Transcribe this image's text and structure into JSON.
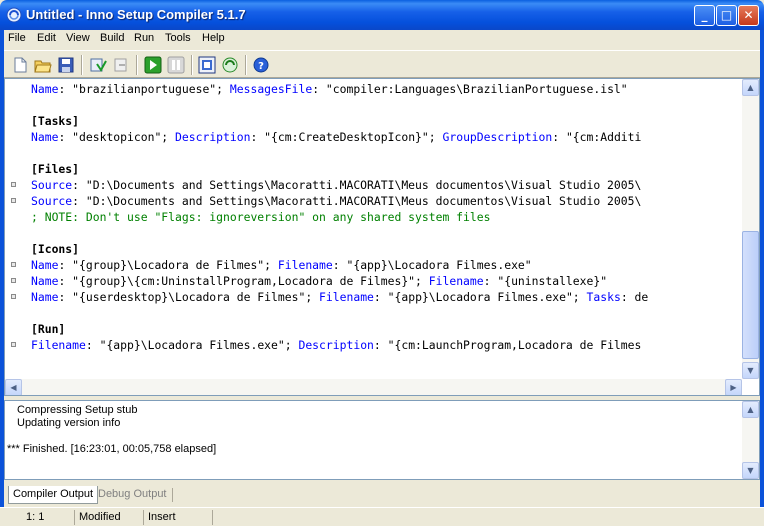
{
  "window": {
    "title": "Untitled - Inno Setup Compiler 5.1.7",
    "minimize": "_",
    "maximize": "□",
    "close": "✕"
  },
  "menu": [
    "File",
    "Edit",
    "View",
    "Build",
    "Run",
    "Tools",
    "Help"
  ],
  "toolbar": [
    "new-icon",
    "open-icon",
    "save-icon",
    "compile-icon",
    "stop-compile-icon",
    "run-icon",
    "pause-icon",
    "target-setup-icon",
    "uninstall-icon",
    "help-icon"
  ],
  "editor": {
    "lines": [
      {
        "parts": [
          [
            "kw",
            "Name"
          ],
          [
            "t",
            ": \"brazilianportuguese\"; "
          ],
          [
            "kw",
            "MessagesFile"
          ],
          [
            "t",
            ": \"compiler:Languages\\BrazilianPortuguese.isl\""
          ]
        ],
        "marker": false
      },
      {
        "parts": [],
        "marker": false
      },
      {
        "parts": [
          [
            "sec",
            "[Tasks]"
          ]
        ],
        "marker": false
      },
      {
        "parts": [
          [
            "kw",
            "Name"
          ],
          [
            "t",
            ": \"desktopicon\"; "
          ],
          [
            "kw",
            "Description"
          ],
          [
            "t",
            ": \"{cm:CreateDesktopIcon}\"; "
          ],
          [
            "kw",
            "GroupDescription"
          ],
          [
            "t",
            ": \"{cm:Additi"
          ]
        ],
        "marker": false
      },
      {
        "parts": [],
        "marker": false
      },
      {
        "parts": [
          [
            "sec",
            "[Files]"
          ]
        ],
        "marker": false
      },
      {
        "parts": [
          [
            "kw",
            "Source"
          ],
          [
            "t",
            ": \"D:\\Documents and Settings\\Macoratti.MACORATI\\Meus documentos\\Visual Studio 2005\\"
          ]
        ],
        "marker": true
      },
      {
        "parts": [
          [
            "kw",
            "Source"
          ],
          [
            "t",
            ": \"D:\\Documents and Settings\\Macoratti.MACORATI\\Meus documentos\\Visual Studio 2005\\"
          ]
        ],
        "marker": true
      },
      {
        "parts": [
          [
            "cmt",
            "; NOTE: Don't use \"Flags: ignoreversion\" on any shared system files"
          ]
        ],
        "marker": false
      },
      {
        "parts": [],
        "marker": false
      },
      {
        "parts": [
          [
            "sec",
            "[Icons]"
          ]
        ],
        "marker": false
      },
      {
        "parts": [
          [
            "kw",
            "Name"
          ],
          [
            "t",
            ": \"{group}\\Locadora de Filmes\"; "
          ],
          [
            "kw",
            "Filename"
          ],
          [
            "t",
            ": \"{app}\\Locadora Filmes.exe\""
          ]
        ],
        "marker": true
      },
      {
        "parts": [
          [
            "kw",
            "Name"
          ],
          [
            "t",
            ": \"{group}\\{cm:UninstallProgram,Locadora de Filmes}\"; "
          ],
          [
            "kw",
            "Filename"
          ],
          [
            "t",
            ": \"{uninstallexe}\""
          ]
        ],
        "marker": true
      },
      {
        "parts": [
          [
            "kw",
            "Name"
          ],
          [
            "t",
            ": \"{userdesktop}\\Locadora de Filmes\"; "
          ],
          [
            "kw",
            "Filename"
          ],
          [
            "t",
            ": \"{app}\\Locadora Filmes.exe\"; "
          ],
          [
            "kw",
            "Tasks"
          ],
          [
            "t",
            ": de"
          ]
        ],
        "marker": true
      },
      {
        "parts": [],
        "marker": false
      },
      {
        "parts": [
          [
            "sec",
            "[Run]"
          ]
        ],
        "marker": false
      },
      {
        "parts": [
          [
            "kw",
            "Filename"
          ],
          [
            "t",
            ": \"{app}\\Locadora Filmes.exe\"; "
          ],
          [
            "kw",
            "Description"
          ],
          [
            "t",
            ": \"{cm:LaunchProgram,Locadora de Filmes"
          ]
        ],
        "marker": true
      }
    ]
  },
  "output": {
    "lines": [
      "Compressing Setup stub",
      "Updating version info",
      "",
      "*** Finished.  [16:23:01, 00:05,758 elapsed]"
    ]
  },
  "tabs": [
    "Compiler Output",
    "Debug Output"
  ],
  "status": {
    "position": "1:   1",
    "modified": "Modified",
    "mode": "Insert"
  }
}
